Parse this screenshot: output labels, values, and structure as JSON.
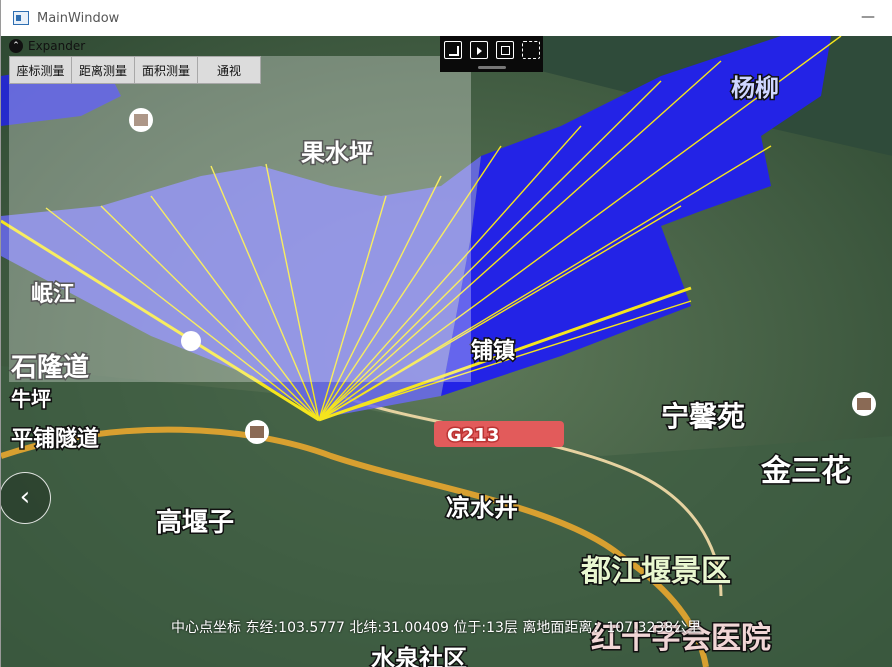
{
  "window": {
    "title": "MainWindow",
    "minimize_glyph": "—"
  },
  "expander": {
    "label": "Expander",
    "icon": "chevron-up-icon"
  },
  "toolbar": {
    "buttons": [
      "座标测量",
      "距离测量",
      "面积测量",
      "通视"
    ]
  },
  "map_tools": {
    "icons": [
      "export-icon",
      "pointer-icon",
      "fit-view-icon",
      "selection-icon"
    ]
  },
  "map_labels": {
    "guoshuiping": "果水坪",
    "g213": "G213",
    "ningxinyuan": "宁馨苑",
    "jinsan": "金三花",
    "liangshuijing": "凉水井",
    "gaoyanzi": "高堰子",
    "dujiangyan": "都江堰景区",
    "redcross": "红十字会医院",
    "tunnel1": "石隆道",
    "tunnel2": "平铺隧道",
    "ping": "牛坪",
    "yangliu": "杨柳",
    "mingjiang": "岷江",
    "zhen": "铺镇",
    "village": "水泉社区"
  },
  "status_bar": {
    "text": "中心点坐标 东经:103.5777 北纬:31.00409 位于:13层 离地面距离：107.3238公里"
  },
  "nav": {
    "back_glyph": "‹"
  },
  "colors": {
    "visible_area": "#6a6af0",
    "hidden_area": "#2323e6",
    "sight_line": "#f5e51e",
    "road": "#e0a020"
  }
}
